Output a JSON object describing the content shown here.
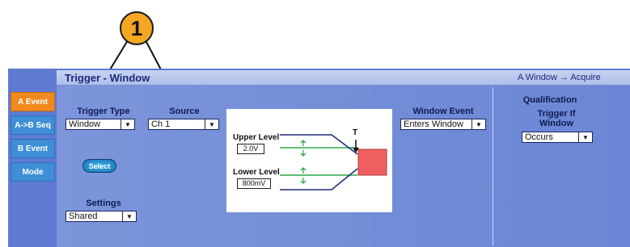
{
  "callout": {
    "number": "1"
  },
  "window": {
    "title": "Trigger - Window",
    "status": "A Window → Acquire"
  },
  "tabs": [
    {
      "label": "A Event",
      "active": true
    },
    {
      "label": "A->B Seq",
      "active": false
    },
    {
      "label": "B Event",
      "active": false
    },
    {
      "label": "Mode",
      "active": false
    }
  ],
  "trigger_type": {
    "label": "Trigger Type",
    "value": "Window"
  },
  "source": {
    "label": "Source",
    "value": "Ch 1"
  },
  "select_button": {
    "label": "Select"
  },
  "settings": {
    "label": "Settings",
    "value": "Shared"
  },
  "diagram": {
    "upper_label": "Upper Level",
    "upper_value": "2.0V",
    "lower_label": "Lower Level",
    "lower_value": "800mV",
    "marker": "T"
  },
  "window_event": {
    "label": "Window Event",
    "value": "Enters Window"
  },
  "qualification": {
    "heading": "Qualification",
    "sublabel": "Trigger If Window",
    "value": "Occurs"
  },
  "colors": {
    "panel": "#5f7bd1",
    "tab": "#3f8ed6",
    "tab_active": "#f08a1e",
    "callout": "#f5a623",
    "level_line": "#2ea84a",
    "window_box": "#f06060"
  }
}
